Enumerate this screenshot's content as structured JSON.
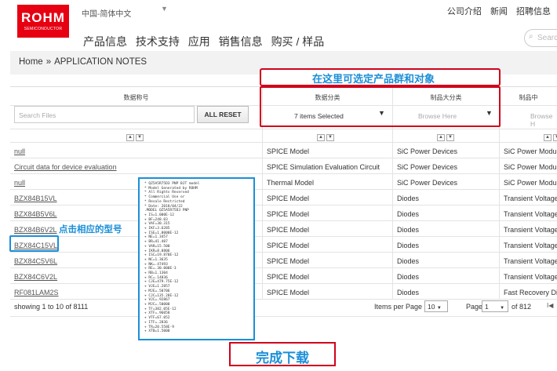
{
  "header": {
    "logo_brand": "ROHM",
    "logo_sub": "SEMICONDUCTOR",
    "language": "中国-简体中文",
    "lang_caret": "▼",
    "top_links": [
      "公司介绍",
      "新闻",
      "招聘信息"
    ],
    "nav": [
      "产品信息",
      "技术支持",
      "应用",
      "销售信息",
      "购买 / 样品"
    ],
    "search_placeholder": "Searc"
  },
  "breadcrumb": {
    "home": "Home",
    "sep": "»",
    "current": "APPLICATION NOTES"
  },
  "table": {
    "columns": [
      "数据称号",
      "数据分类",
      "制品大分类",
      "制品中"
    ],
    "search_placeholder": "Search Files",
    "reset_label": "ALL RESET",
    "filter_category_value": "7 items Selected",
    "filter_group_placeholder": "Browse Here",
    "filter_sub_placeholder": "Browse H",
    "sort_up": "▲",
    "sort_down": "▼",
    "rows": [
      [
        "null",
        "SPICE Model",
        "SiC Power Devices",
        "SiC Power Module"
      ],
      [
        "Circuit data for device evaluation",
        "SPICE Simulation Evaluation Circuit",
        "SiC Power Devices",
        "SiC Power Module"
      ],
      [
        "null",
        "Thermal Model",
        "SiC Power Devices",
        "SiC Power Module"
      ],
      [
        "BZX84B15VL",
        "SPICE Model",
        "Diodes",
        "Transient Voltage"
      ],
      [
        "BZX84B5V6L",
        "SPICE Model",
        "Diodes",
        "Transient Voltage"
      ],
      [
        "BZX84B6V2L",
        "SPICE Model",
        "Diodes",
        "Transient Voltage"
      ],
      [
        "BZX84C15VL",
        "SPICE Model",
        "Diodes",
        "Transient Voltage"
      ],
      [
        "BZX84C5V6L",
        "SPICE Model",
        "Diodes",
        "Transient Voltage"
      ],
      [
        "BZX84C6V2L",
        "SPICE Model",
        "Diodes",
        "Transient Voltage"
      ],
      [
        "RF081LAM2S",
        "SPICE Model",
        "Diodes",
        "Fast Recovery Di"
      ]
    ]
  },
  "pagination": {
    "showing": "showing 1 to 10 of 8111",
    "items_per_page_label": "Items per Page",
    "items_per_page": "10",
    "page_label": "Page",
    "page": "1",
    "of_pages": "of 812",
    "nav_glyph": "I◀"
  },
  "annotations": {
    "filter_hint": "在这里可选定产品群和对象",
    "click_model_hint": "点击相应的型号",
    "done": "完成下载",
    "model_file_lines": [
      "* QZ5A5R75D3 PNP BJT model",
      "* Model Generated by ROHM",
      "* All Rights Reserved",
      "* Commercial Use or",
      "* Resale Restricted",
      "* Date: 2018/04/22",
      ".MODEL QZ5A5R75D3 PNP",
      "+ IS=1.000E-12",
      "+ BF=248.03",
      "+ VAF=30.315",
      "+ IKF=3.6285",
      "+ ISE=1.0000E-12",
      "+ NE=1.3457",
      "+ BR=41.407",
      "+ VAR=15.500",
      "+ IKR=8.0806",
      "+ ISC=19.870E-12",
      "+ NC=1.3635",
      "+ NK=.47493",
      "+ RE=.30.000E-3",
      "+ RB=1.1304",
      "+ RC=.14836",
      "+ CJE=479.75E-12",
      "+ VJE=1.2857",
      "+ MJE=.50706",
      "+ CJC=135.28E-12",
      "+ VJC=.92867",
      "+ MJC=.50000",
      "+ TF=382.05E-12",
      "+ XTF=.96058",
      "+ VTF=67.052",
      "+ ITF=.2836",
      "+ TR=20.558E-9",
      "+ XTB=1.5000"
    ]
  }
}
